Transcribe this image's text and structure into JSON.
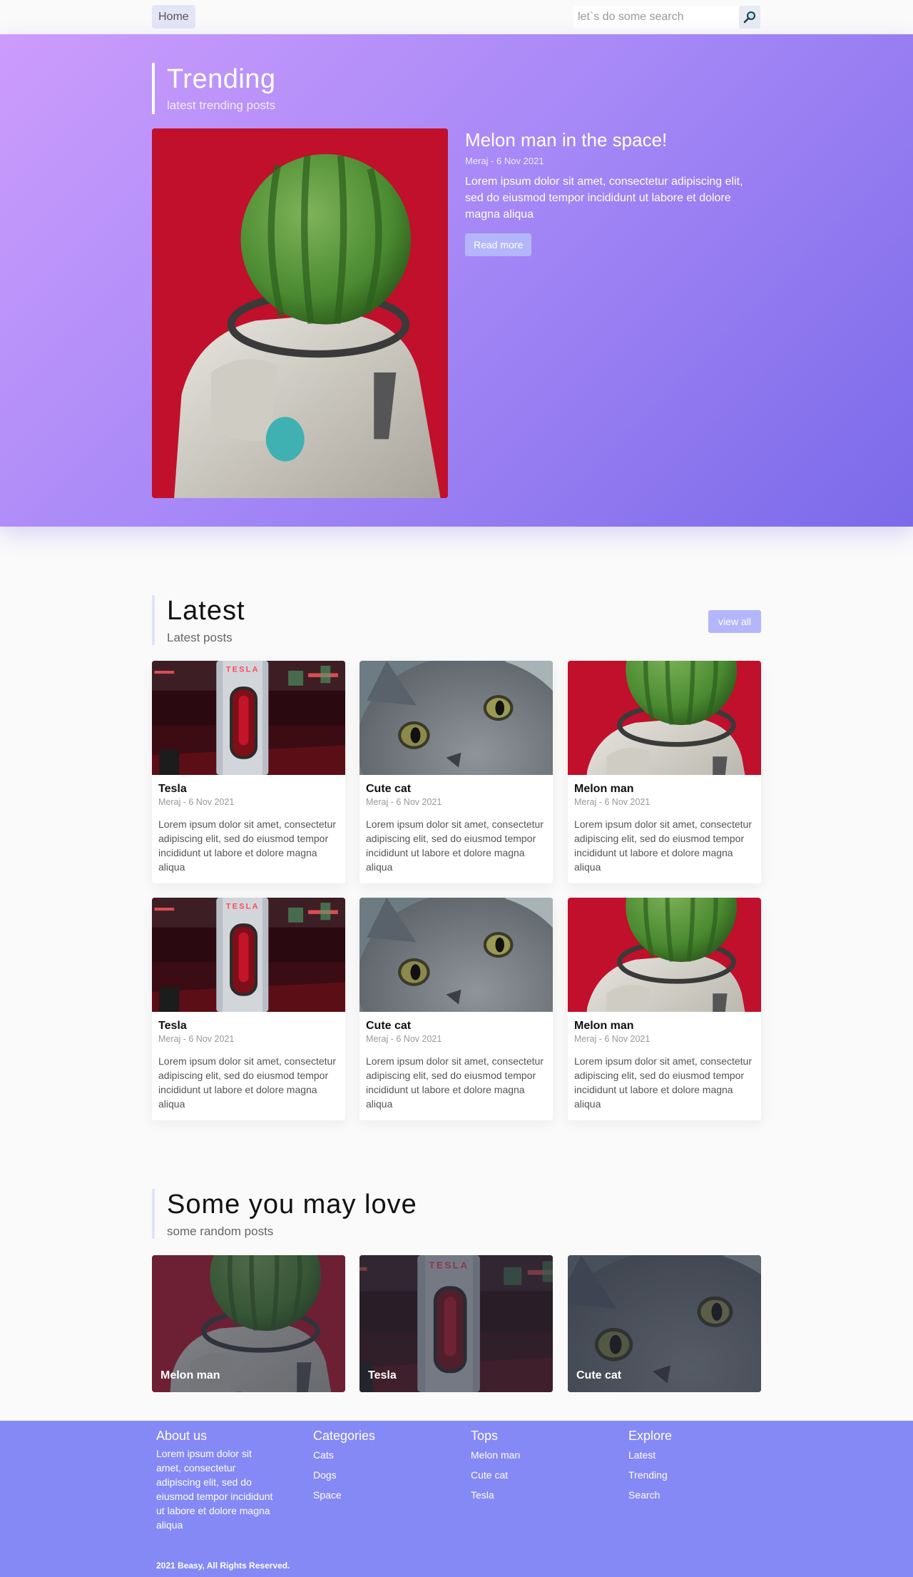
{
  "nav": {
    "home_label": "Home",
    "search_placeholder": "let`s do some search"
  },
  "trending": {
    "title": "Trending",
    "subtitle": "latest trending posts",
    "post": {
      "title": "Melon man in the space!",
      "meta": "Meraj - 6 Nov 2021",
      "description": "Lorem ipsum dolor sit amet, consectetur adipiscing elit, sed do eiusmod tempor incididunt ut labore et dolore magna aliqua",
      "button": "Read more"
    }
  },
  "latest": {
    "title": "Latest",
    "subtitle": "Latest posts",
    "view_all": "view all",
    "posts": [
      {
        "title": "Tesla",
        "meta": "Meraj - 6 Nov 2021",
        "description": "Lorem ipsum dolor sit amet, consectetur adipiscing elit, sed do eiusmod tempor incididunt ut labore et dolore magna aliqua",
        "image": "tesla-charger"
      },
      {
        "title": "Cute cat",
        "meta": "Meraj - 6 Nov 2021",
        "description": "Lorem ipsum dolor sit amet, consectetur adipiscing elit, sed do eiusmod tempor incididunt ut labore et dolore magna aliqua",
        "image": "gray-cat"
      },
      {
        "title": "Melon man",
        "meta": "Meraj - 6 Nov 2021",
        "description": "Lorem ipsum dolor sit amet, consectetur adipiscing elit, sed do eiusmod tempor incididunt ut labore et dolore magna aliqua",
        "image": "melon-astronaut"
      },
      {
        "title": "Tesla",
        "meta": "Meraj - 6 Nov 2021",
        "description": "Lorem ipsum dolor sit amet, consectetur adipiscing elit, sed do eiusmod tempor incididunt ut labore et dolore magna aliqua",
        "image": "tesla-charger"
      },
      {
        "title": "Cute cat",
        "meta": "Meraj - 6 Nov 2021",
        "description": "Lorem ipsum dolor sit amet, consectetur adipiscing elit, sed do eiusmod tempor incididunt ut labore et dolore magna aliqua",
        "image": "gray-cat"
      },
      {
        "title": "Melon man",
        "meta": "Meraj - 6 Nov 2021",
        "description": "Lorem ipsum dolor sit amet, consectetur adipiscing elit, sed do eiusmod tempor incididunt ut labore et dolore magna aliqua",
        "image": "melon-astronaut"
      }
    ]
  },
  "love": {
    "title": "Some you may love",
    "subtitle": "some random posts",
    "posts": [
      {
        "title": "Melon man",
        "image": "melon-astronaut"
      },
      {
        "title": "Tesla",
        "image": "tesla-charger"
      },
      {
        "title": "Cute cat",
        "image": "gray-cat"
      }
    ]
  },
  "footer": {
    "about_title": "About us",
    "about_text": "Lorem ipsum dolor sit amet, consectetur adipiscing elit, sed do eiusmod tempor incididunt ut labore et dolore magna aliqua",
    "categories_title": "Categories",
    "categories": [
      "Cats",
      "Dogs",
      "Space"
    ],
    "tops_title": "Tops",
    "tops": [
      "Melon man",
      "Cute cat",
      "Tesla"
    ],
    "explore_title": "Explore",
    "explore": [
      "Latest",
      "Trending",
      "Search"
    ],
    "copyright": "2021 Beasy, All Rights Reserved."
  },
  "colors": {
    "accent": "#8589f6",
    "gradient_start": "#cc9cfc",
    "gradient_end": "#7b6ae9",
    "button": "#b4b6fb"
  },
  "icons": {
    "search": "magnifier-icon"
  }
}
